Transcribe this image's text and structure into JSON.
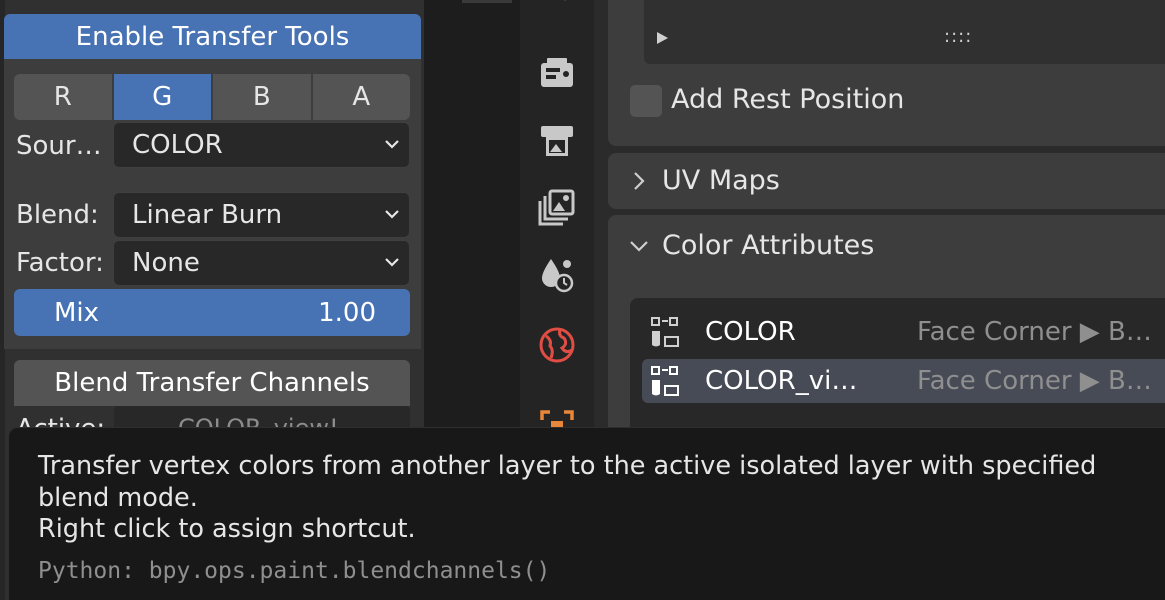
{
  "left_panel": {
    "enable_button": "Enable Transfer Tools",
    "channels": [
      {
        "label": "R",
        "active": false
      },
      {
        "label": "G",
        "active": true
      },
      {
        "label": "B",
        "active": false
      },
      {
        "label": "A",
        "active": false
      }
    ],
    "source": {
      "label": "Sour…",
      "value": "COLOR"
    },
    "blend": {
      "label": "Blend:",
      "value": "Linear Burn"
    },
    "factor": {
      "label": "Factor:",
      "value": "None"
    },
    "mix": {
      "label": "Mix",
      "value": "1.00"
    },
    "blend_channels_button": "Blend Transfer Channels",
    "active": {
      "label": "Active:",
      "value": "COLOR_view!"
    }
  },
  "properties": {
    "dots": "::::",
    "add_rest_position": {
      "label": "Add Rest Position",
      "checked": false
    },
    "uv_maps": {
      "title": "UV Maps",
      "expanded": false
    },
    "color_attributes": {
      "title": "Color Attributes",
      "expanded": true,
      "items": [
        {
          "name": "COLOR",
          "domain": "Face Corner ▶ B…",
          "active": false
        },
        {
          "name": "COLOR_vi…",
          "domain": "Face Corner ▶ B…",
          "active": true
        }
      ]
    }
  },
  "tabs": [
    "tool-icon",
    "render-icon",
    "output-icon",
    "view-layer-icon",
    "scene-icon",
    "world-icon",
    "object-icon"
  ],
  "tooltip": {
    "description": "Transfer vertex colors from another layer to the active isolated layer with specified blend mode.",
    "hint": "Right click to assign shortcut.",
    "python": "Python: bpy.ops.paint.blendchannels()"
  },
  "colors": {
    "accent": "#4772b3",
    "panel": "#3d3d3d",
    "background": "#2b2b2b",
    "tooltip_bg": "#181818",
    "world_icon": "#e04d45",
    "object_icon": "#e8863a"
  }
}
